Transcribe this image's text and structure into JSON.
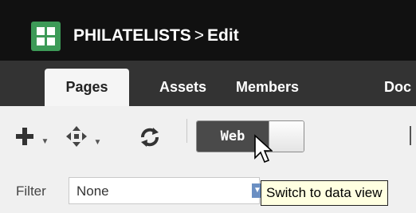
{
  "header": {
    "app_name": "PHILATELISTS",
    "separator": ">",
    "page": "Edit"
  },
  "tabs": [
    {
      "label": "Pages",
      "active": true
    },
    {
      "label": "Assets"
    },
    {
      "label": "Members"
    },
    {
      "label": "Doc"
    }
  ],
  "toolbar": {
    "add_icon": "plus-icon",
    "move_icon": "move-arrows-icon",
    "refresh_icon": "refresh-icon",
    "view_toggle_label": "Web"
  },
  "filter": {
    "label": "Filter",
    "value": "None"
  },
  "tooltip": {
    "text": "Switch to data view"
  },
  "colors": {
    "titlebar": "#111111",
    "tabbar": "#333333",
    "logo": "#3d9a57",
    "toolbar": "#f0f0f0",
    "toggle_on": "#4a4a4a",
    "tooltip_bg": "#ffffe1"
  }
}
